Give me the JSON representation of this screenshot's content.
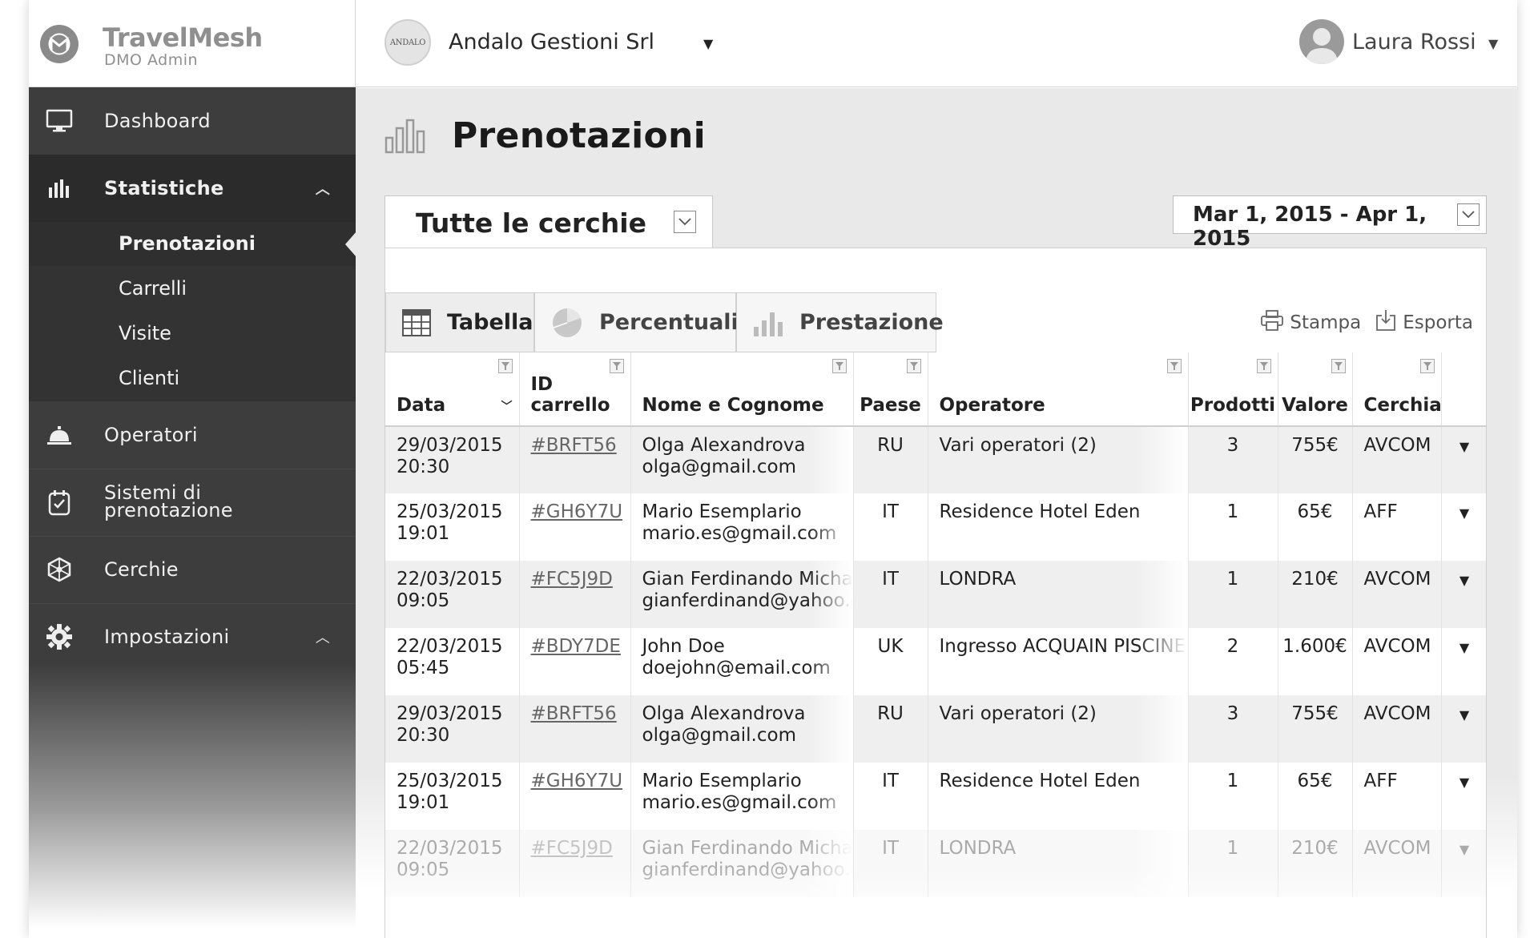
{
  "brand": {
    "name": "TravelMesh",
    "subtitle": "DMO Admin"
  },
  "sidebar": {
    "items": [
      {
        "label": "Dashboard",
        "icon": "monitor-icon"
      },
      {
        "label": "Statistiche",
        "icon": "bar-chart-icon",
        "expanded": true,
        "children": [
          {
            "label": "Prenotazioni",
            "selected": true
          },
          {
            "label": "Carrelli"
          },
          {
            "label": "Visite"
          },
          {
            "label": "Clienti"
          }
        ]
      },
      {
        "label": "Operatori",
        "icon": "bell-icon"
      },
      {
        "label": "Sistemi di prenotazione",
        "line1": "Sistemi di",
        "line2": "prenotazione",
        "icon": "calendar-check-icon"
      },
      {
        "label": "Cerchie",
        "icon": "network-icon"
      },
      {
        "label": "Impostazioni",
        "icon": "gear-icon"
      }
    ]
  },
  "topbar": {
    "org_logo_text": "ANDALO",
    "org_name": "Andalo Gestioni Srl",
    "user_name": "Laura Rossi"
  },
  "page": {
    "title": "Prenotazioni",
    "circle_filter": "Tutte le cerchie",
    "date_range": "Mar 1, 2015 - Apr 1, 2015",
    "tabs": [
      {
        "label": "Tabella",
        "icon": "table-icon",
        "active": true
      },
      {
        "label": "Percentuali",
        "icon": "pie-chart-icon"
      },
      {
        "label": "Prestazione",
        "icon": "bar-chart-icon"
      }
    ],
    "actions": {
      "print": "Stampa",
      "export": "Esporta"
    }
  },
  "table": {
    "columns": [
      "Data",
      "ID carrello",
      "Nome e Cognome",
      "Paese",
      "Operatore",
      "Prodotti",
      "Valore",
      "Cerchia"
    ],
    "rows": [
      {
        "date": "29/03/2015",
        "time": "20:30",
        "id": "#BRFT56",
        "name": "Olga Alexandrova",
        "email": "olga@gmail.com",
        "country": "RU",
        "operator": "Vari operatori (2)",
        "products": "3",
        "value": "755€",
        "circle": "AVCOM"
      },
      {
        "date": "25/03/2015",
        "time": "19:01",
        "id": "#GH6Y7U",
        "name": "Mario Esemplario",
        "email": "mario.es@gmail.com",
        "country": "IT",
        "operator": "Residence Hotel Eden",
        "products": "1",
        "value": "65€",
        "circle": "AFF"
      },
      {
        "date": "22/03/2015",
        "time": "09:05",
        "id": "#FC5J9D",
        "name": "Gian Ferdinando Michael",
        "email": "gianferdinand@yahoo.com",
        "country": "IT",
        "operator": "LONDRA",
        "products": "1",
        "value": "210€",
        "circle": "AVCOM"
      },
      {
        "date": "22/03/2015",
        "time": "05:45",
        "id": "#BDY7DE",
        "name": "John Doe",
        "email": "doejohn@email.com",
        "country": "UK",
        "operator": "Ingresso ACQUAIN PISCINE",
        "products": "2",
        "value": "1.600€",
        "circle": "AVCOM"
      },
      {
        "date": "29/03/2015",
        "time": "20:30",
        "id": "#BRFT56",
        "name": "Olga Alexandrova",
        "email": "olga@gmail.com",
        "country": "RU",
        "operator": "Vari operatori (2)",
        "products": "3",
        "value": "755€",
        "circle": "AVCOM"
      },
      {
        "date": "25/03/2015",
        "time": "19:01",
        "id": "#GH6Y7U",
        "name": "Mario Esemplario",
        "email": "mario.es@gmail.com",
        "country": "IT",
        "operator": "Residence Hotel Eden",
        "products": "1",
        "value": "65€",
        "circle": "AFF"
      },
      {
        "date": "22/03/2015",
        "time": "09:05",
        "id": "#FC5J9D",
        "name": "Gian Ferdinando Michael",
        "email": "gianferdinand@yahoo.com",
        "country": "IT",
        "operator": "LONDRA",
        "products": "1",
        "value": "210€",
        "circle": "AVCOM"
      }
    ]
  }
}
